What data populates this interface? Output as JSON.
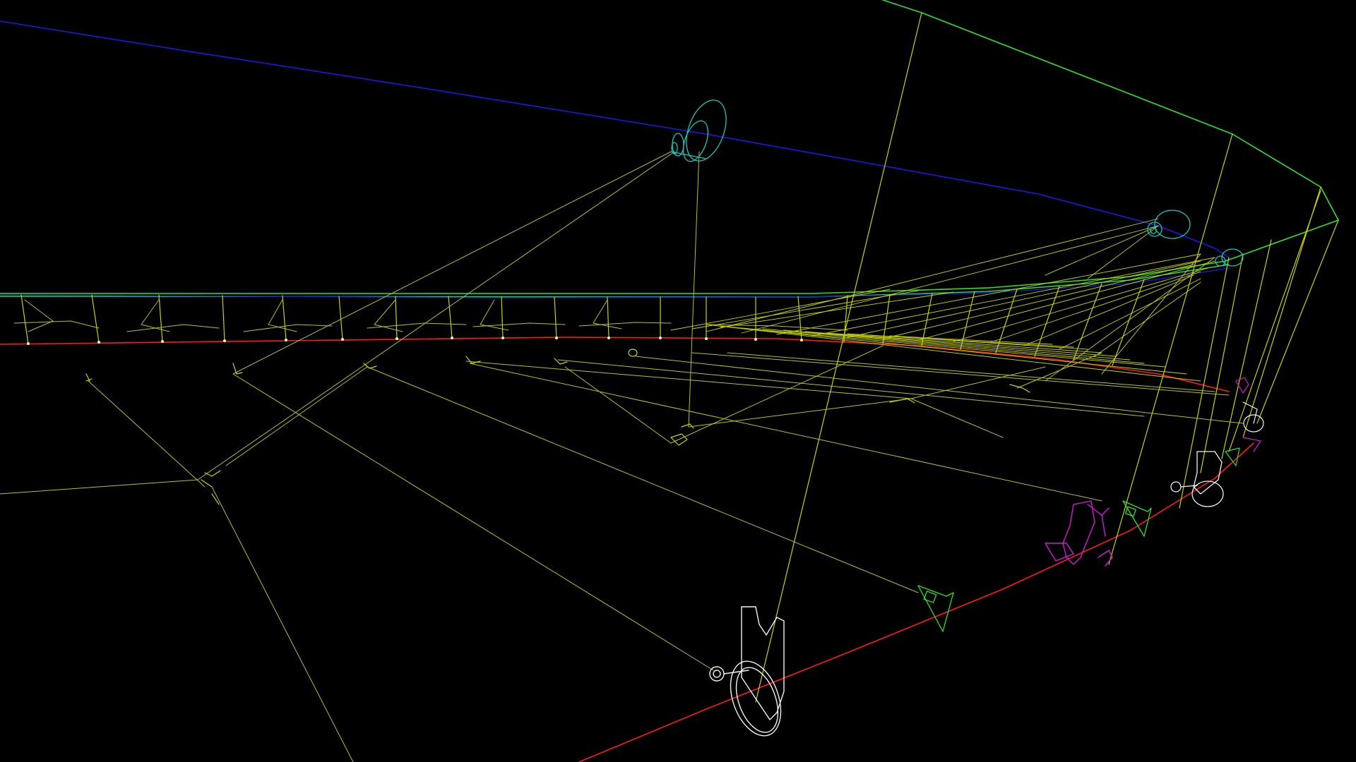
{
  "view": {
    "type": "3d-wireframe-viewport",
    "background": "#000000"
  },
  "colors": {
    "outer_frame": "#2fe02f",
    "upper_rail": "#1a1ae6",
    "lower_rail": "#ff1a1a",
    "struts": "#c8d400",
    "parts_primary": "#f2f2f2",
    "parts_secondary": "#d41ad4",
    "parts_tertiary": "#17c9b8"
  },
  "components": {
    "large_bracket": "bracket-part",
    "small_brackets": "bracket-part",
    "spheres": "pivot-sphere",
    "truss": "truss-frame"
  }
}
